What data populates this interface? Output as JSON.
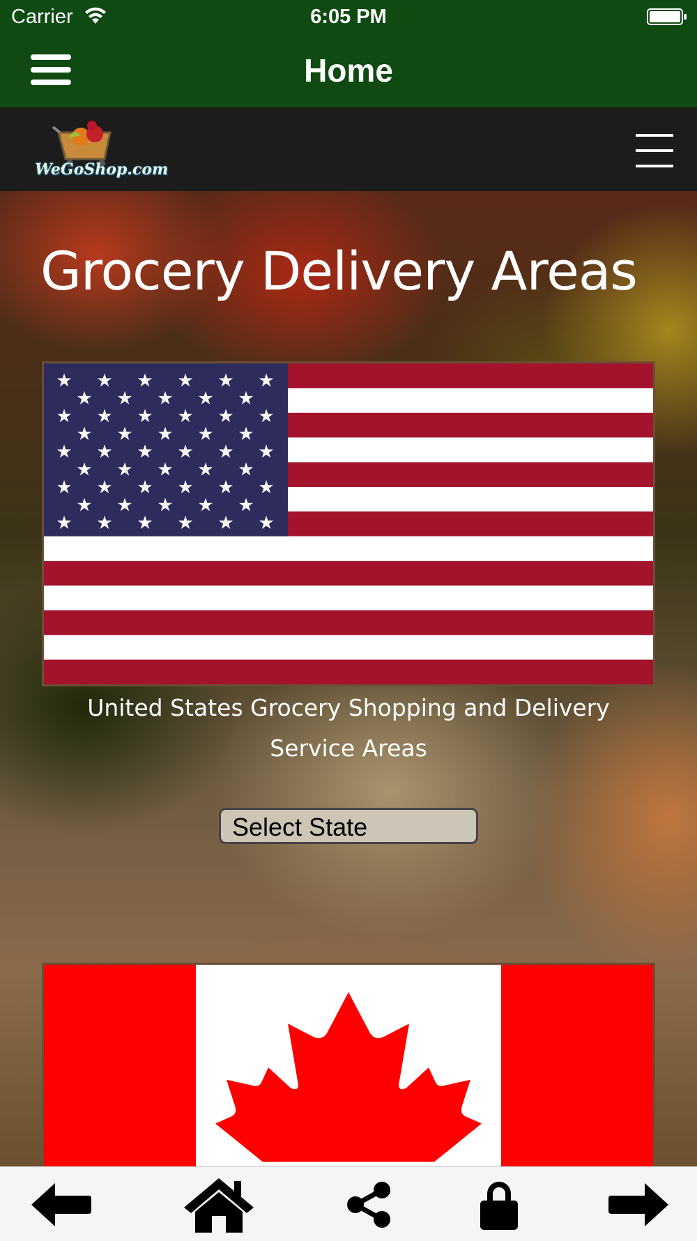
{
  "status_bar": {
    "carrier": "Carrier",
    "time": "6:05 PM"
  },
  "header": {
    "title": "Home"
  },
  "site_nav": {
    "logo_text": "WeGoShop.com"
  },
  "main": {
    "heading": "Grocery Delivery Areas",
    "us_caption": "United States Grocery Shopping and Delivery Service Areas",
    "state_select": {
      "selected": "Select State"
    }
  },
  "toolbar": {
    "icons": [
      "back-arrow-icon",
      "home-icon",
      "share-icon",
      "lock-icon",
      "forward-arrow-icon"
    ]
  },
  "colors": {
    "header_bg": "#0f4a12",
    "nav_bg": "#1c1c1c",
    "us_red": "#a3132b",
    "us_blue": "#2e2c5c",
    "ca_red": "#ff0000"
  }
}
